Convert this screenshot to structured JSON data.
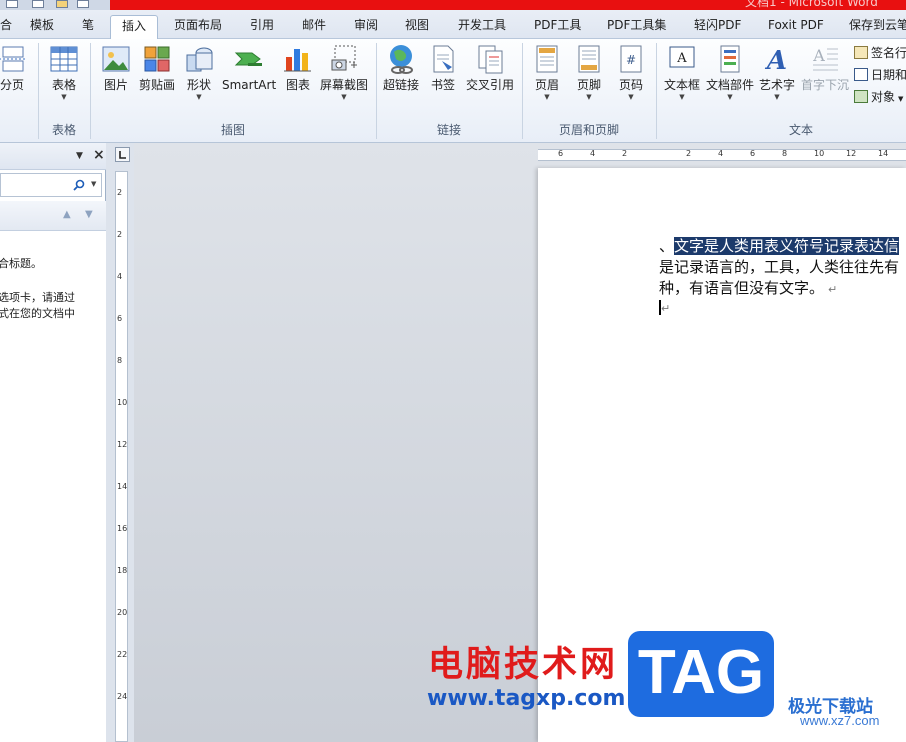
{
  "window": {
    "title": "文档1 - Microsoft Word"
  },
  "tabs": [
    {
      "label": "合"
    },
    {
      "label": "模板"
    },
    {
      "label": "笔"
    },
    {
      "label": "插入"
    },
    {
      "label": "页面布局"
    },
    {
      "label": "引用"
    },
    {
      "label": "邮件"
    },
    {
      "label": "审阅"
    },
    {
      "label": "视图"
    },
    {
      "label": "开发工具"
    },
    {
      "label": "PDF工具"
    },
    {
      "label": "PDF工具集"
    },
    {
      "label": "轻闪PDF"
    },
    {
      "label": "Foxit PDF"
    },
    {
      "label": "保存到云笔"
    }
  ],
  "active_tab": "插入",
  "ribbon": {
    "pages": {
      "fenye": "分页"
    },
    "tables": {
      "table_button": "表格",
      "group": "表格"
    },
    "illustrations": {
      "picture": "图片",
      "clipart": "剪贴画",
      "shapes": "形状",
      "smartart": "SmartArt",
      "chart": "图表",
      "screenshot": "屏幕截图",
      "group": "插图"
    },
    "links": {
      "hyperlink": "超链接",
      "bookmark": "书签",
      "crossref": "交叉引用",
      "group": "链接"
    },
    "header_footer": {
      "header": "页眉",
      "footer": "页脚",
      "page_number": "页码",
      "group": "页眉和页脚"
    },
    "text": {
      "textbox": "文本框",
      "quickparts": "文档部件",
      "wordart": "艺术字",
      "dropcap": "首字下沉",
      "signature": "签名行",
      "datetime": "日期和",
      "object": "对象",
      "group": "文本"
    }
  },
  "nav_pane": {
    "line1": "合标题。",
    "line2": "选项卡，请通过",
    "line3": "式在您的文档中"
  },
  "document": {
    "line1_prefix": "、",
    "line1_selected": "文字是人类用表义符号记录表达信",
    "line2": "是记录语言的，工具，人类往往先有",
    "line3": "种，有语言但没有文字。",
    "para_mark": "↵",
    "cursor_mark": "↵"
  },
  "ruler": {
    "h_ticks": [
      "6",
      "4",
      "2",
      "",
      "2",
      "4",
      "6",
      "8",
      "10",
      "12",
      "14"
    ],
    "v_ticks": [
      "2",
      "2",
      "4",
      "6",
      "8",
      "10",
      "12",
      "14",
      "16",
      "18",
      "20",
      "22",
      "24"
    ]
  },
  "watermark": {
    "title": "电脑技术网",
    "url": "www.tagxp.com",
    "badge": "TAG",
    "site_name": "极光下载站",
    "site_url": "www.xz7.com"
  },
  "colors": {
    "accent_red": "#e81010",
    "selection": "#1c3a6b",
    "tag_blue": "#1e6ce0"
  }
}
